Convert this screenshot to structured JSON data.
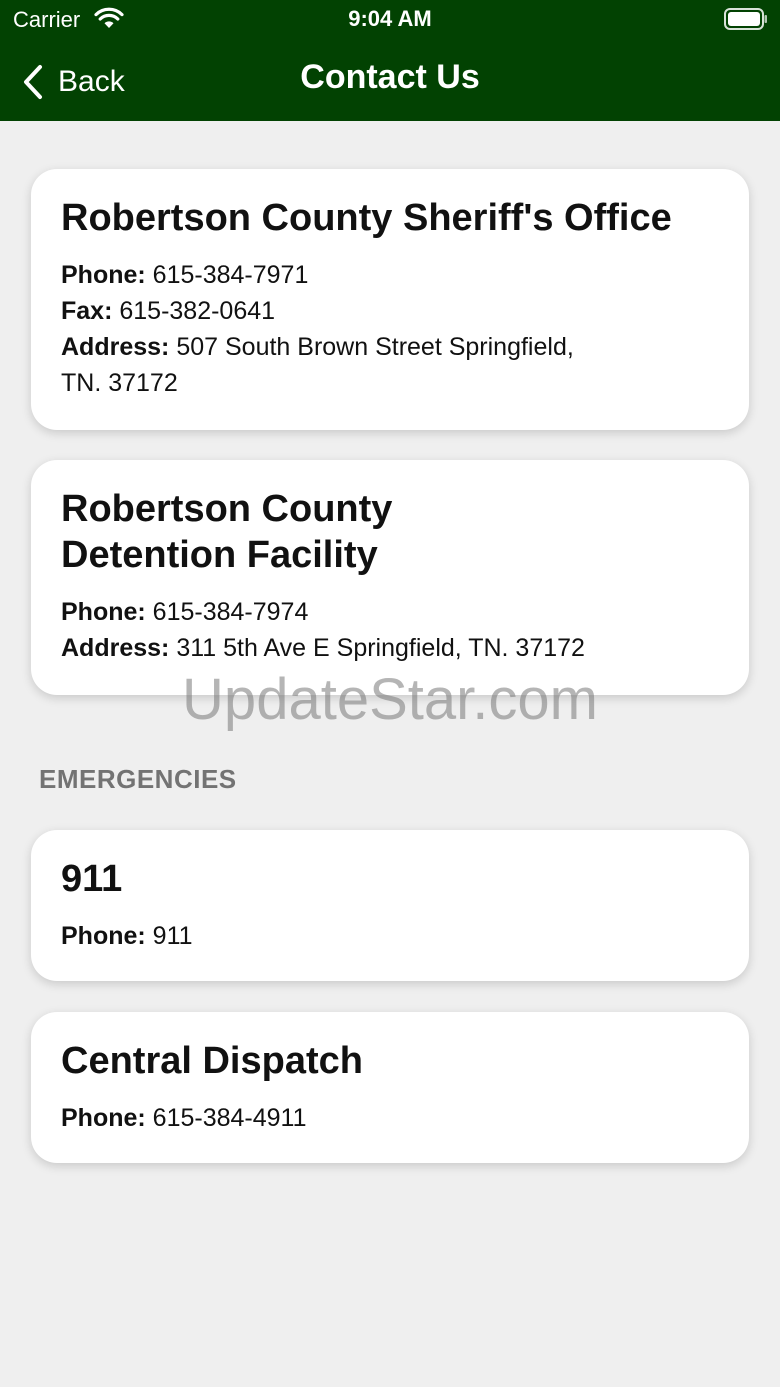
{
  "status_bar": {
    "carrier": "Carrier",
    "time": "9:04 AM"
  },
  "nav": {
    "back_label": "Back",
    "title": "Contact Us"
  },
  "contacts": [
    {
      "title_line1": "Robertson County Sheriff's Office",
      "phone_label": "Phone:",
      "phone": "615-384-7971",
      "fax_label": "Fax:",
      "fax": "615-382-0641",
      "address_label": "Address:",
      "address_line1": "507 South Brown Street Springfield,",
      "address_line2": "TN. 37172"
    },
    {
      "title_line1": "Robertson County",
      "title_line2": "Detention Facility",
      "phone_label": "Phone:",
      "phone": "615-384-7974",
      "address_label": "Address:",
      "address_line1": "311 5th Ave E Springfield, TN. 37172"
    }
  ],
  "emergencies": {
    "header": "EMERGENCIES",
    "items": [
      {
        "title": "911",
        "phone_label": "Phone:",
        "phone": "911"
      },
      {
        "title": "Central Dispatch",
        "phone_label": "Phone:",
        "phone": "615-384-4911"
      }
    ]
  },
  "watermark": "UpdateStar.com",
  "colors": {
    "header_bg": "#024202",
    "page_bg": "#efefef",
    "section_text": "#737373"
  }
}
